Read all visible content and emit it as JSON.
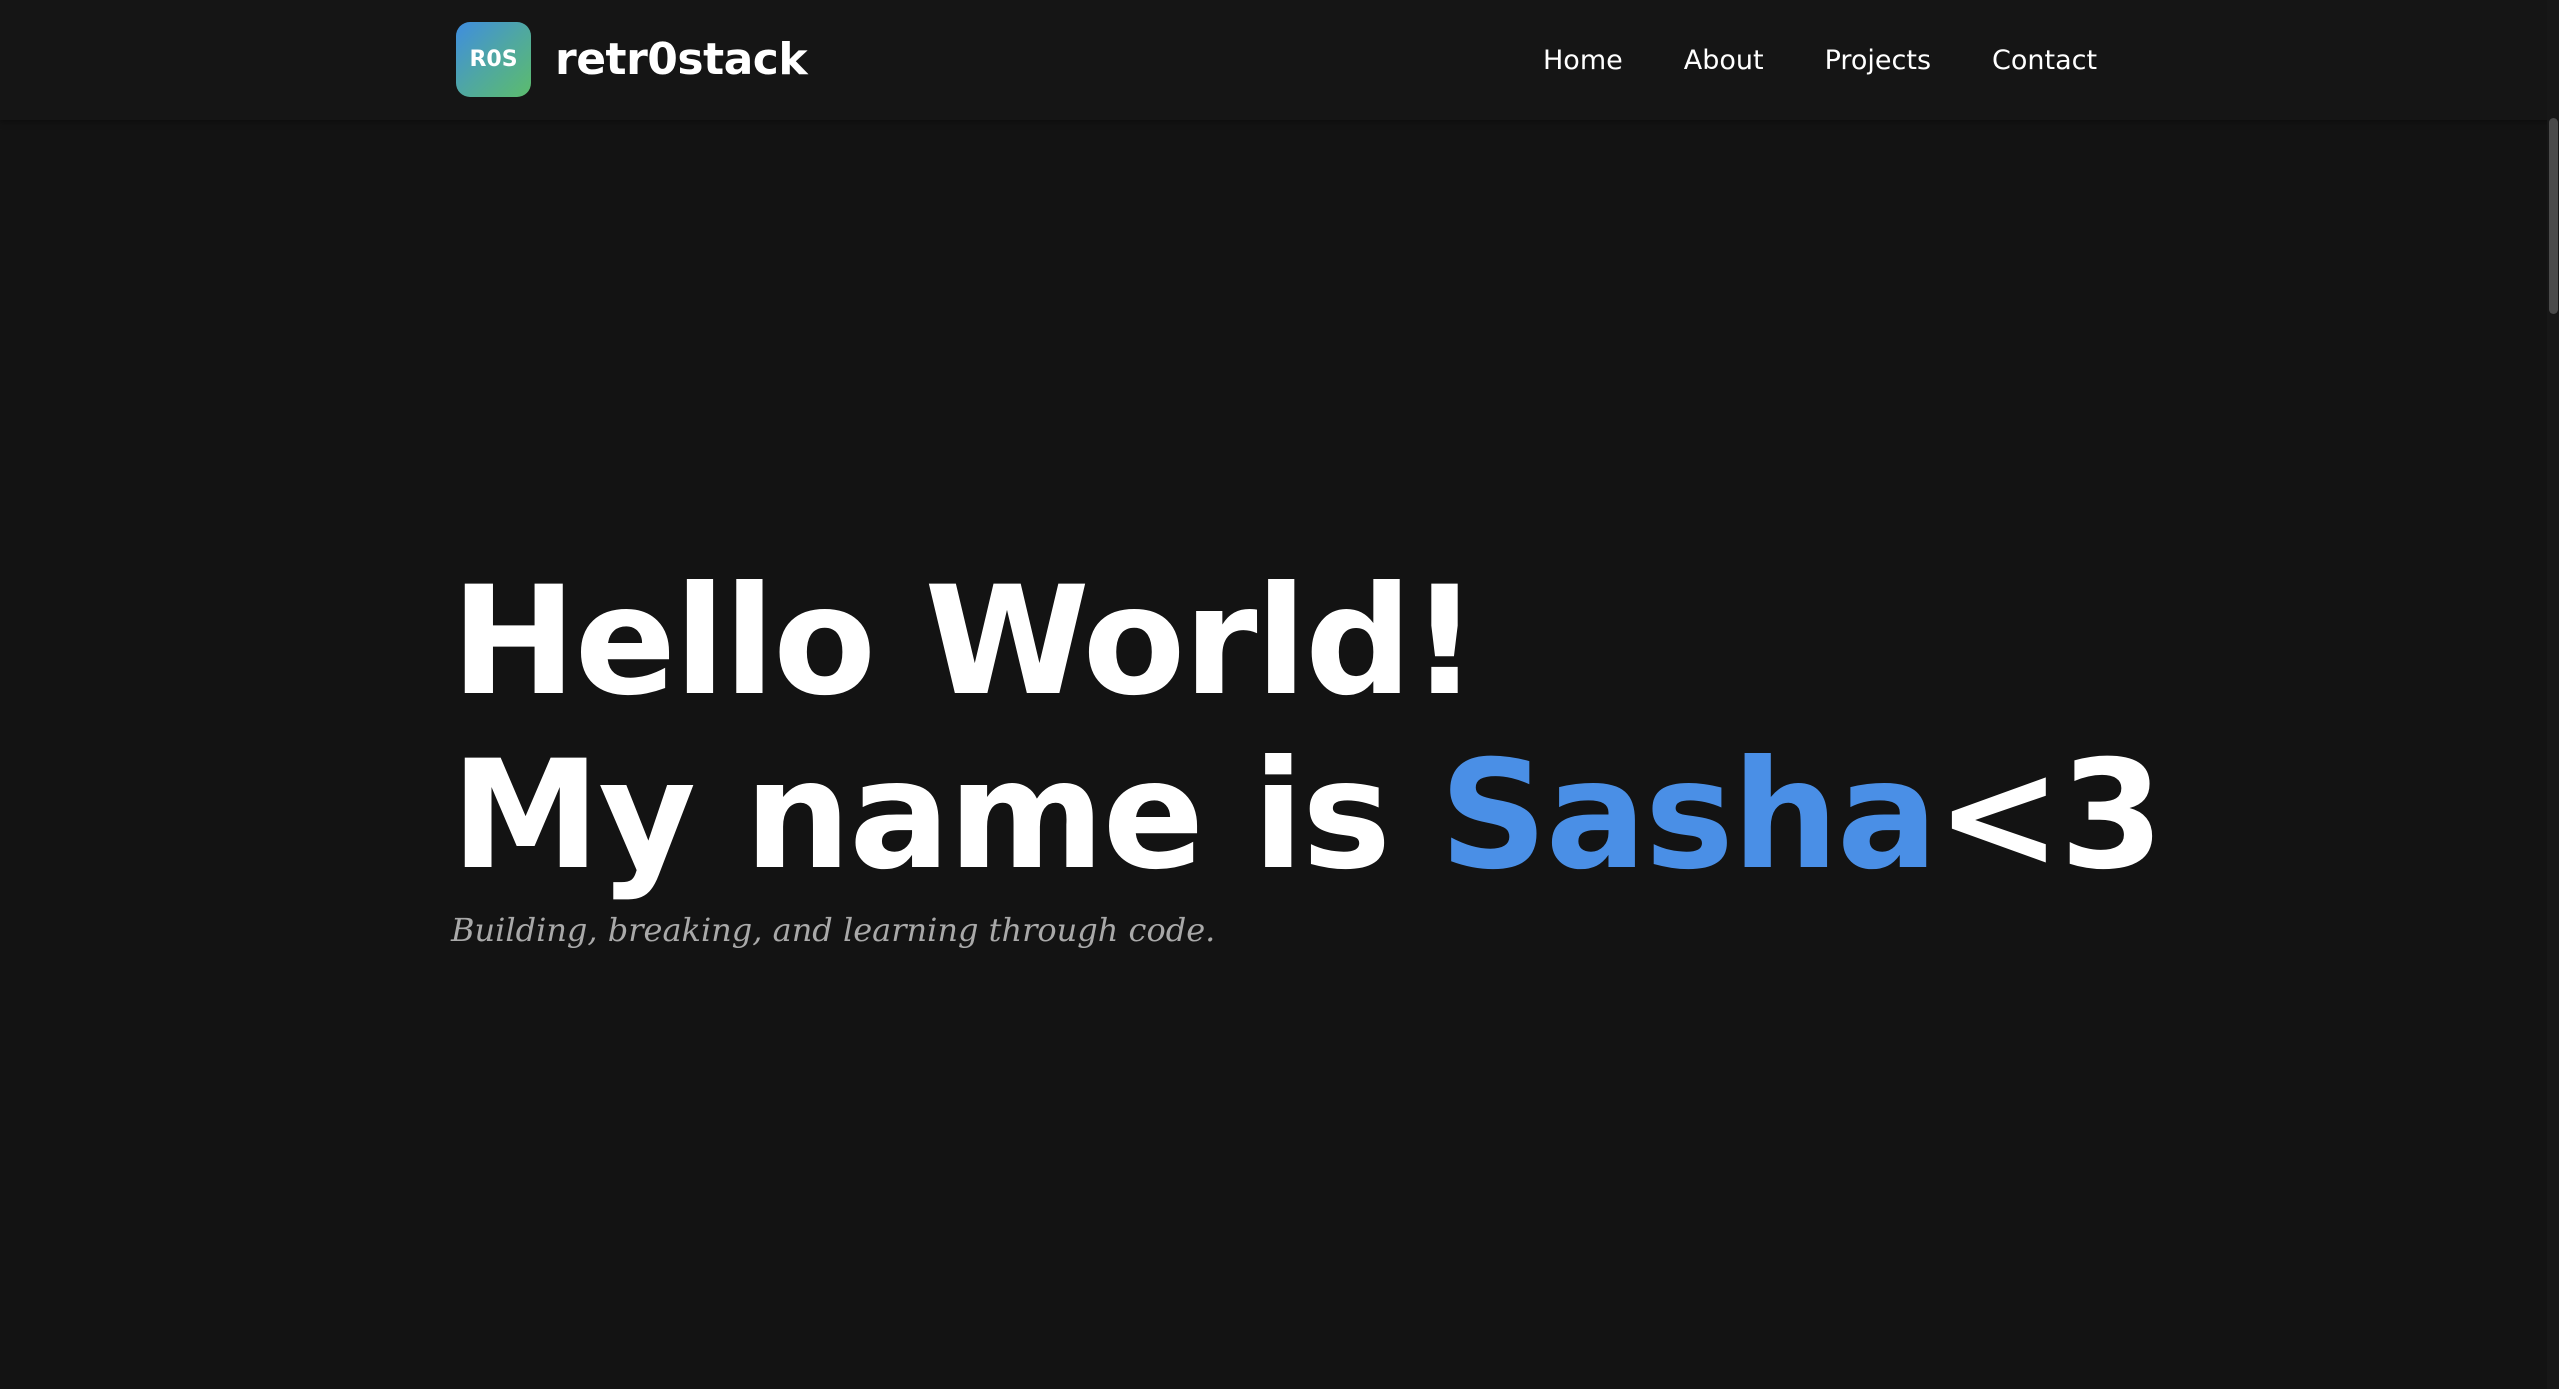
{
  "header": {
    "logo_badge": "R0S",
    "site_name": "retr0stack",
    "logo_gradient": [
      "#3f8de0",
      "#5cbc6c"
    ],
    "nav": [
      {
        "label": "Home"
      },
      {
        "label": "About"
      },
      {
        "label": "Projects"
      },
      {
        "label": "Contact"
      }
    ]
  },
  "hero": {
    "line1": "Hello World!",
    "line2_prefix": "My name is ",
    "name": "Sasha",
    "line2_suffix": "<3",
    "tagline": "Building, breaking, and learning through code.",
    "accent_color": "#4a8fe6"
  },
  "theme": {
    "background": "#131313",
    "text": "#ffffff",
    "muted_text": "#a9a9a9"
  }
}
